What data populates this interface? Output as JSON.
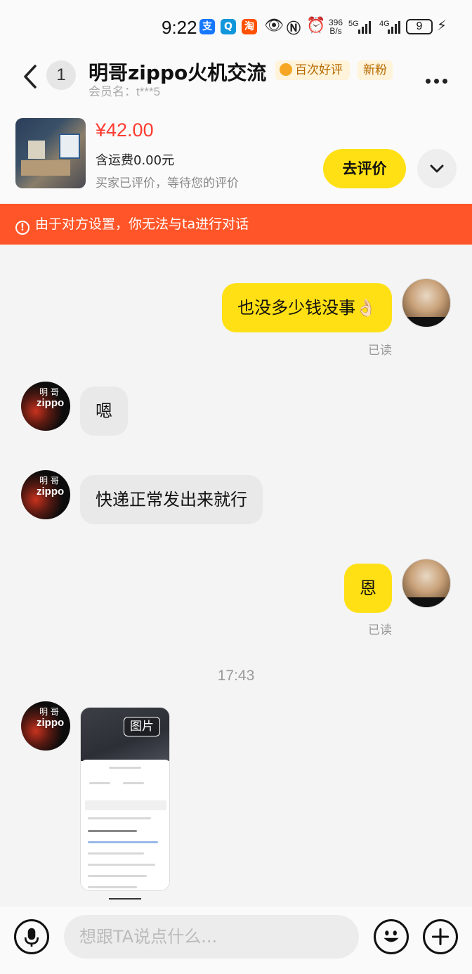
{
  "status_bar": {
    "time": "9:22",
    "app_icons": [
      {
        "name": "alipay-icon",
        "glyph": "支",
        "color": "#1677ff"
      },
      {
        "name": "qq-icon",
        "glyph": "Q",
        "color": "#1296db"
      },
      {
        "name": "taobao-icon",
        "glyph": "淘",
        "color": "#ff5000"
      }
    ],
    "net_speed": "396",
    "net_speed_unit": "B/s",
    "signal_1": "5G",
    "signal_2": "4G",
    "battery": "9"
  },
  "header": {
    "unread_count": "1",
    "title": "明哥zippo火机交流",
    "badge_review": "百次好评",
    "badge_new_fan": "新粉",
    "member_label": "会员名：t***5"
  },
  "product": {
    "price": "¥42.00",
    "shipping": "含运费0.00元",
    "status": "买家已评价，等待您的评价",
    "review_button": "去评价"
  },
  "warning": {
    "text": "由于对方设置，你无法与ta进行对话"
  },
  "messages": [
    {
      "sender": "me",
      "text": "也没多少钱没事👌🏻",
      "read_status": "已读"
    },
    {
      "sender": "ta",
      "text": "嗯"
    },
    {
      "sender": "ta",
      "text": "快递正常发出来就行"
    },
    {
      "sender": "me",
      "text": "恩",
      "read_status": "已读"
    }
  ],
  "timestamp": "17:43",
  "image_message": {
    "tag": "图片"
  },
  "input": {
    "placeholder": "想跟TA说点什么..."
  },
  "colors": {
    "accent_yellow": "#ffe014",
    "warning_orange": "#ff5528",
    "price_red": "#ff3b30"
  }
}
